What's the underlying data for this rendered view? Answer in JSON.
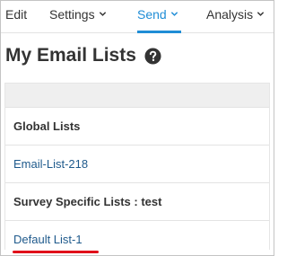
{
  "nav": {
    "edit": "Edit",
    "settings": "Settings",
    "send": "Send",
    "analysis": "Analysis",
    "active": "send",
    "accent_color": "#1f8dd6"
  },
  "title": {
    "text": "My Email Lists",
    "help_icon": "question-circle-icon"
  },
  "lists": {
    "groups": [
      {
        "label": "Global Lists",
        "items": [
          "Email-List-218"
        ]
      },
      {
        "label": "Survey Specific Lists : test",
        "items": [
          "Default List-1"
        ]
      }
    ],
    "highlight_color": "#e0101a"
  }
}
